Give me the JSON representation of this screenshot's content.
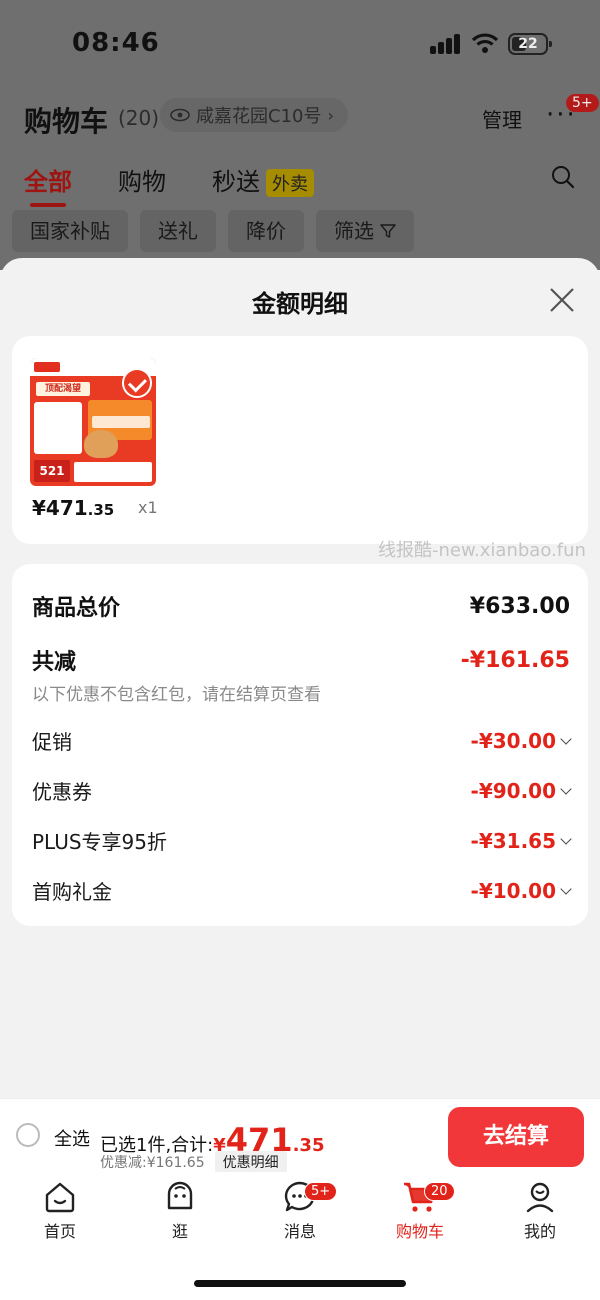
{
  "status": {
    "time": "08:46",
    "battery": "22"
  },
  "header": {
    "title": "购物车",
    "count": "(20)",
    "address": "咸嘉花园C10号",
    "manage": "管理",
    "more_badge": "5+"
  },
  "tabs": [
    {
      "label": "全部"
    },
    {
      "label": "购物"
    },
    {
      "label": "秒送"
    }
  ],
  "waimai_tag": "外卖",
  "chips": [
    "国家补贴",
    "送礼",
    "降价",
    "筛选"
  ],
  "sheet": {
    "title": "金额明细",
    "product": {
      "price_int": "¥471",
      "price_dec": ".35",
      "qty": "x1",
      "img_banner": "顶配渴望",
      "img_price": "521"
    },
    "watermark": "线报酷-new.xianbao.fun",
    "total_label": "商品总价",
    "total_value": "¥633.00",
    "reduce_label": "共减",
    "reduce_value": "-¥161.65",
    "note": "以下优惠不包含红包，请在结算页查看",
    "items": [
      {
        "label": "促销",
        "value": "-¥30.00"
      },
      {
        "label": "优惠券",
        "value": "-¥90.00"
      },
      {
        "label": "PLUS专享95折",
        "value": "-¥31.65"
      },
      {
        "label": "首购礼金",
        "value": "-¥10.00"
      }
    ]
  },
  "checkout": {
    "select_all": "全选",
    "selected_text": "已选1件,合计:",
    "currency": "¥",
    "total_int": "471",
    "total_dec": ".35",
    "discount_text": "优惠减:¥161.65",
    "detail_btn": "优惠明细",
    "pay_btn": "去结算"
  },
  "tabbar": [
    {
      "label": "首页",
      "icon": "home-icon"
    },
    {
      "label": "逛",
      "icon": "face-icon"
    },
    {
      "label": "消息",
      "icon": "message-icon",
      "badge": "5+"
    },
    {
      "label": "购物车",
      "icon": "cart-icon",
      "badge": "20"
    },
    {
      "label": "我的",
      "icon": "user-icon"
    }
  ],
  "colors": {
    "accent": "#e2231a",
    "pay_button": "#f1373a"
  }
}
